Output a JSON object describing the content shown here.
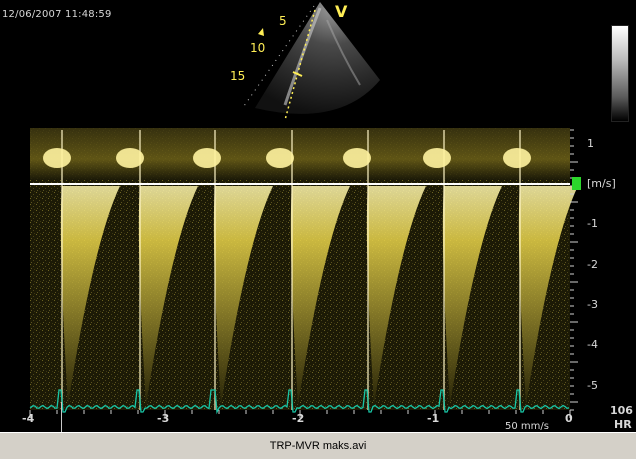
{
  "timestamp": "12/06/2007 11:48:59",
  "sector": {
    "mode_letter": "V",
    "depth_labels": [
      "5",
      "10",
      "15"
    ]
  },
  "doppler": {
    "unit": "[m/s]",
    "velocity_ticks": [
      "1",
      "-1",
      "-2",
      "-3",
      "-4",
      "-5"
    ],
    "time_ticks": [
      "-4",
      "-3",
      "-2",
      "-1",
      "0"
    ],
    "baseline_marker_color": "#2bd62b",
    "ecg_color": "#19c6a6",
    "spectrum_color": "#ffee55"
  },
  "sweep_speed": "50 mm/s",
  "heart_rate": {
    "value": "106",
    "label": "HR"
  },
  "footer": {
    "filename": "TRP-MVR maks.avi"
  }
}
